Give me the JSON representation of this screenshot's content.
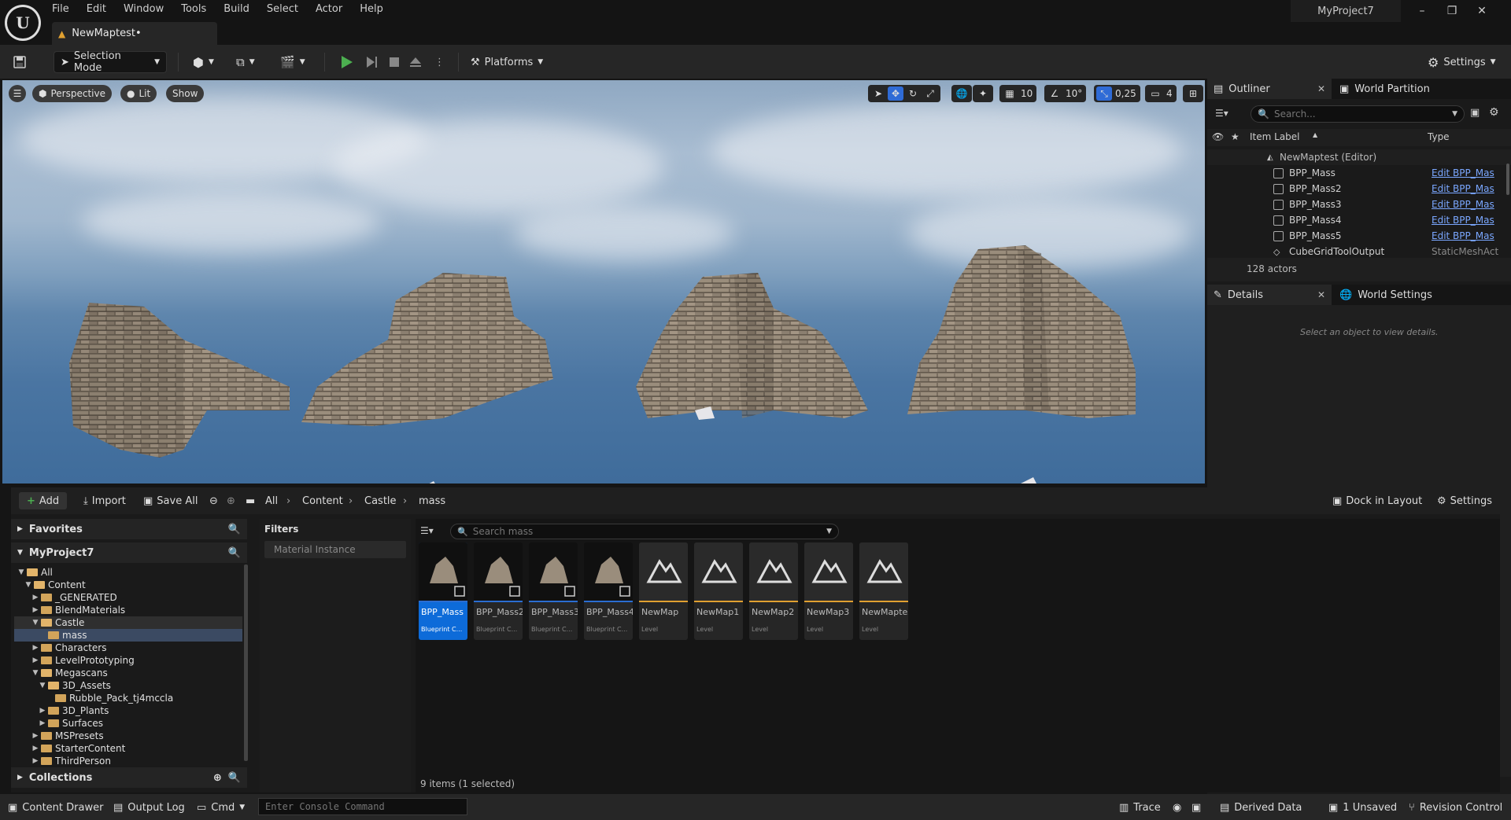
{
  "app": {
    "project": "MyProject7",
    "doc_tab": "NewMaptest•"
  },
  "menu": [
    "File",
    "Edit",
    "Window",
    "Tools",
    "Build",
    "Select",
    "Actor",
    "Help"
  ],
  "toolbar": {
    "selection_mode": "Selection Mode",
    "platforms": "Platforms",
    "settings": "Settings"
  },
  "viewport": {
    "perspective": "Perspective",
    "lit": "Lit",
    "show": "Show",
    "grid_snap": "10",
    "rot_snap": "10°",
    "scale_snap": "0,25",
    "camera_speed": "4"
  },
  "outliner": {
    "tab": "Outliner",
    "tab2": "World Partition",
    "search_placeholder": "Search...",
    "col_label": "Item Label",
    "col_type": "Type",
    "root": "NewMaptest (Editor)",
    "rows": [
      {
        "label": "BPP_Mass",
        "type": "Edit BPP_Mas"
      },
      {
        "label": "BPP_Mass2",
        "type": "Edit BPP_Mas"
      },
      {
        "label": "BPP_Mass3",
        "type": "Edit BPP_Mas"
      },
      {
        "label": "BPP_Mass4",
        "type": "Edit BPP_Mas"
      },
      {
        "label": "BPP_Mass5",
        "type": "Edit BPP_Mas"
      },
      {
        "label": "CubeGridToolOutput",
        "type": "StaticMeshAct"
      }
    ],
    "count": "128 actors"
  },
  "details": {
    "tab": "Details",
    "tab2": "World Settings",
    "empty": "Select an object to view details."
  },
  "content_browser": {
    "add": "Add",
    "import": "Import",
    "save_all": "Save All",
    "crumbs": [
      "All",
      "Content",
      "Castle",
      "mass"
    ],
    "dock": "Dock in Layout",
    "settings": "Settings",
    "favorites": "Favorites",
    "project": "MyProject7",
    "collections": "Collections",
    "filters": "Filters",
    "filter_item": "Material Instance",
    "search_placeholder": "Search mass",
    "status": "9 items (1 selected)",
    "tree": [
      {
        "label": "All",
        "depth": 0
      },
      {
        "label": "Content",
        "depth": 1
      },
      {
        "label": "_GENERATED",
        "depth": 2
      },
      {
        "label": "BlendMaterials",
        "depth": 2
      },
      {
        "label": "Castle",
        "depth": 2
      },
      {
        "label": "mass",
        "depth": 3
      },
      {
        "label": "Characters",
        "depth": 2
      },
      {
        "label": "LevelPrototyping",
        "depth": 2
      },
      {
        "label": "Megascans",
        "depth": 2
      },
      {
        "label": "3D_Assets",
        "depth": 3
      },
      {
        "label": "Rubble_Pack_tj4mccla",
        "depth": 4
      },
      {
        "label": "3D_Plants",
        "depth": 3
      },
      {
        "label": "Surfaces",
        "depth": 3
      },
      {
        "label": "MSPresets",
        "depth": 2
      },
      {
        "label": "StarterContent",
        "depth": 2
      },
      {
        "label": "ThirdPerson",
        "depth": 2
      }
    ],
    "assets": [
      {
        "name": "BPP_Mass",
        "sub": "Blueprint C..."
      },
      {
        "name": "BPP_Mass2",
        "sub": "Blueprint C..."
      },
      {
        "name": "BPP_Mass3",
        "sub": "Blueprint C..."
      },
      {
        "name": "BPP_Mass4",
        "sub": "Blueprint C..."
      },
      {
        "name": "NewMap",
        "sub": "Level"
      },
      {
        "name": "NewMap1",
        "sub": "Level"
      },
      {
        "name": "NewMap2",
        "sub": "Level"
      },
      {
        "name": "NewMap3",
        "sub": "Level"
      },
      {
        "name": "NewMaptest",
        "sub": "Level"
      }
    ]
  },
  "statusbar": {
    "content_drawer": "Content Drawer",
    "output_log": "Output Log",
    "cmd": "Cmd",
    "console_placeholder": "Enter Console Command",
    "trace": "Trace",
    "derived_data": "Derived Data",
    "unsaved": "1 Unsaved",
    "revision": "Revision Control"
  },
  "colors": {
    "accent": "#2f6bd6",
    "folder": "#d2a45a",
    "level_bar": "#e0a030",
    "link": "#7aa7ff"
  }
}
